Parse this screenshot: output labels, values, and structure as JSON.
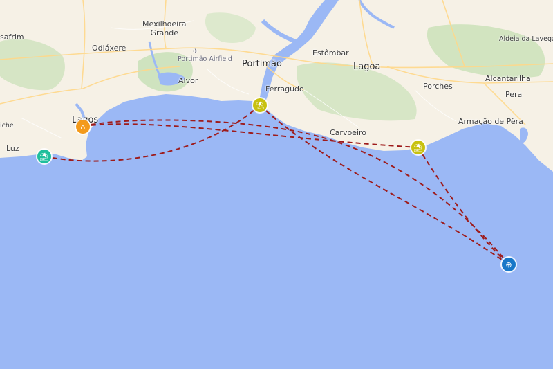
{
  "map": {
    "colors": {
      "sea": "#9bb8f5",
      "land": "#f6f1e6",
      "park": "#c8dfb7",
      "route": "#9e1b1b",
      "marker_home": "#f39a1b",
      "marker_beach_green": "#1fbf9c",
      "marker_beach_yellow": "#c8c10f",
      "marker_globe": "#1777c8"
    },
    "places": {
      "safrim": "safrim",
      "mexilhoeira": "Mexilhoeira\nGrande",
      "odiaxere": "Odiáxere",
      "airfield": "Portimão Airfield",
      "alvor": "Alvor",
      "portimao": "Portimão",
      "estombar": "Estômbar",
      "lagoa": "Lagoa",
      "aldeia": "Aldeia da Lavega",
      "ferragudo": "Ferragudo",
      "porches": "Porches",
      "alcantarilha": "Alcantarilha",
      "pera": "Pera",
      "lagos": "Lagos",
      "iche": "iche",
      "carvoeiro": "Carvoeiro",
      "armacao": "Armação de Pêra",
      "luz": "Luz"
    },
    "markers": [
      {
        "name": "home-marker",
        "icon": "home-icon",
        "glyph": "⌂"
      },
      {
        "name": "beach-marker-luz",
        "icon": "beach-icon",
        "glyph": "⛱"
      },
      {
        "name": "beach-marker-ferragudo",
        "icon": "beach-icon",
        "glyph": "⛱"
      },
      {
        "name": "beach-marker-carvoeiro",
        "icon": "beach-icon",
        "glyph": "⛱"
      },
      {
        "name": "globe-marker",
        "icon": "globe-icon",
        "glyph": "⊕"
      }
    ]
  }
}
